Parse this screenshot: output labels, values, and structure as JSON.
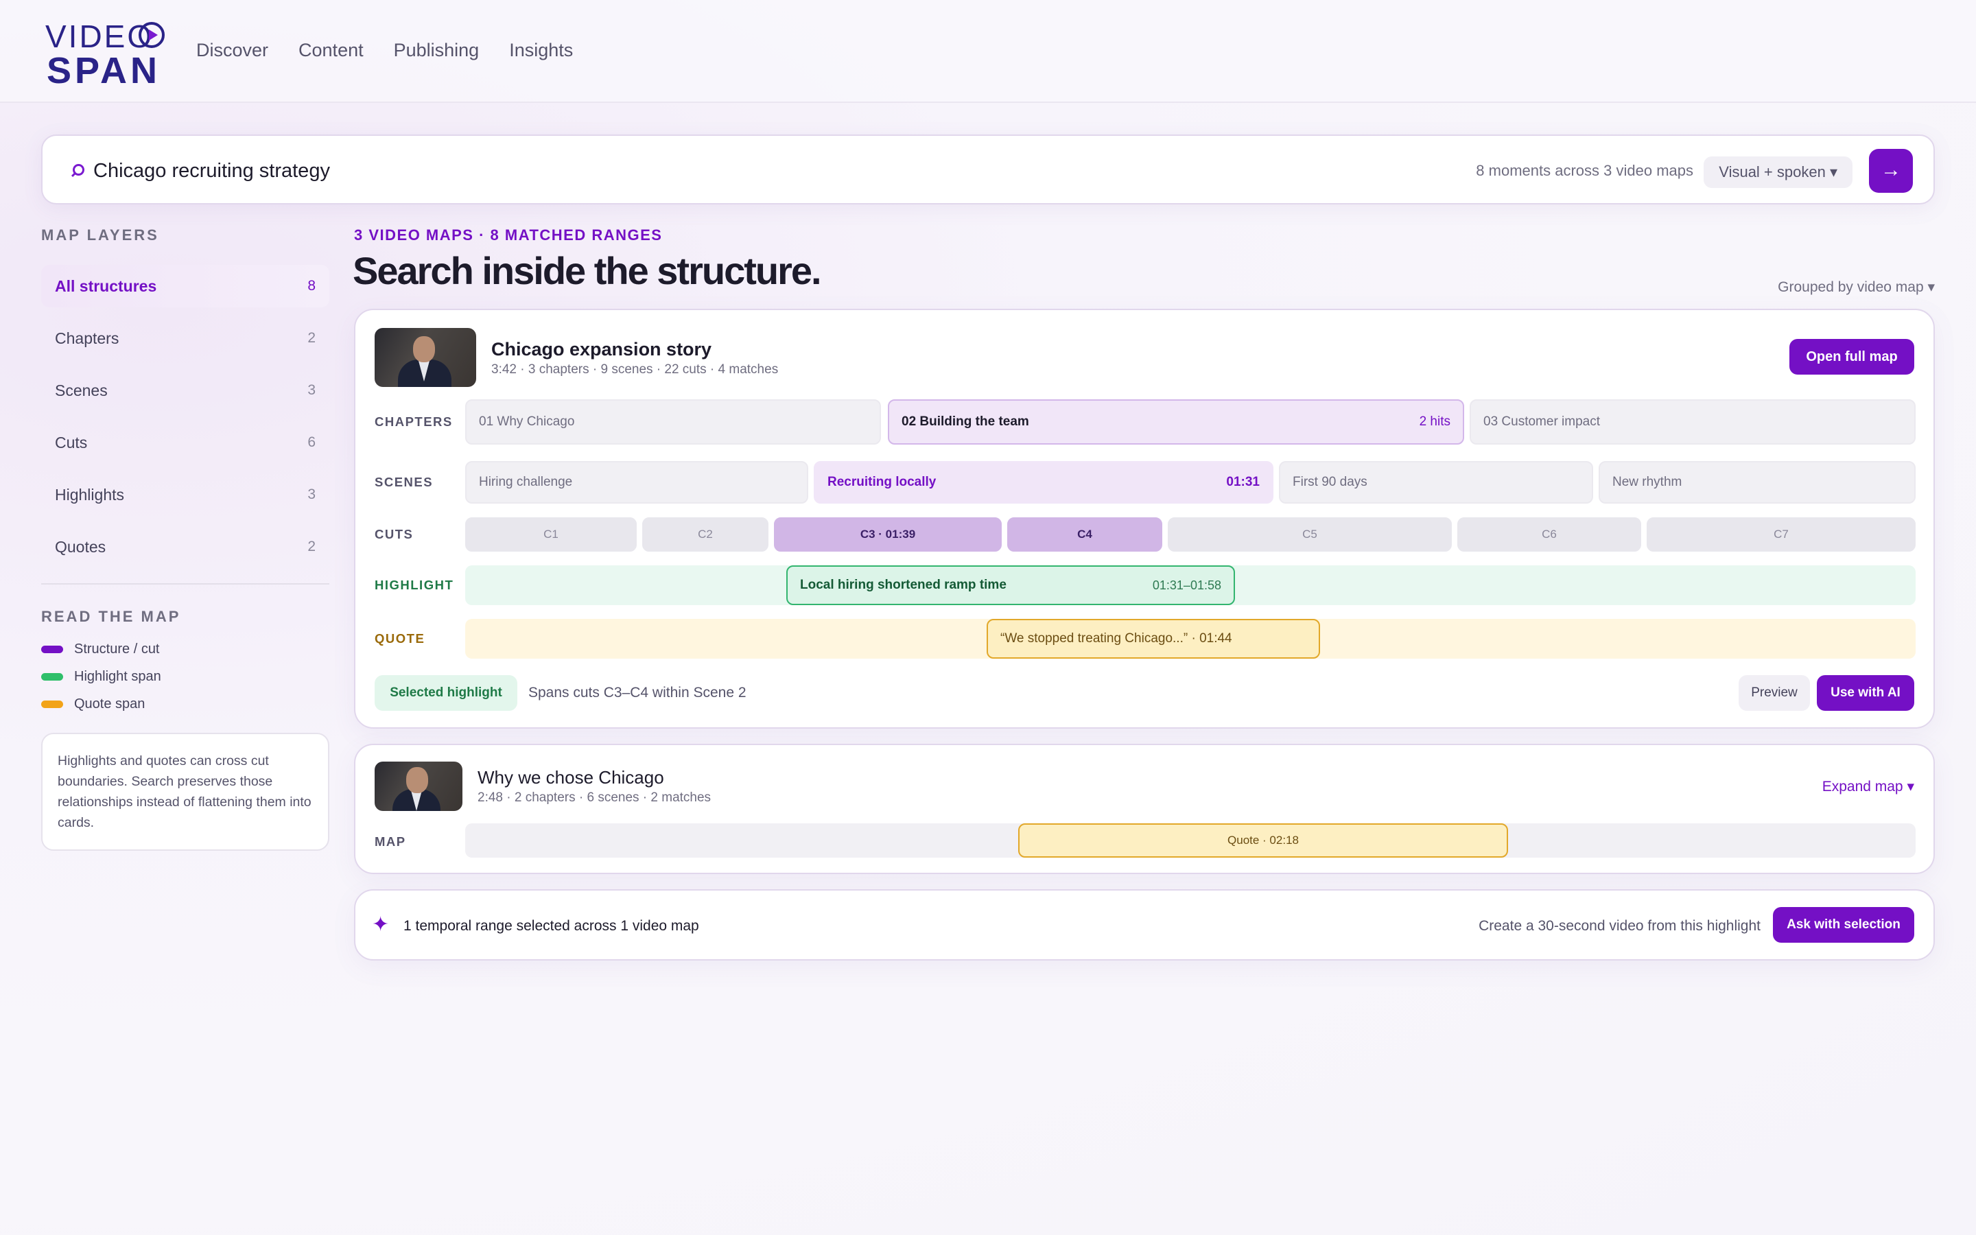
{
  "logo": {
    "line1": "VIDEO",
    "line2": "SPAN"
  },
  "nav": [
    "Discover",
    "Content",
    "Publishing",
    "Insights"
  ],
  "search": {
    "query": "Chicago recruiting strategy",
    "meta": "8 moments across 3 video maps",
    "mode": "Visual + spoken ▾",
    "go": "→"
  },
  "sidebar": {
    "title": "MAP LAYERS",
    "layers": [
      {
        "label": "All structures",
        "count": "8"
      },
      {
        "label": "Chapters",
        "count": "2"
      },
      {
        "label": "Scenes",
        "count": "3"
      },
      {
        "label": "Cuts",
        "count": "6"
      },
      {
        "label": "Highlights",
        "count": "3"
      },
      {
        "label": "Quotes",
        "count": "2"
      }
    ],
    "legend_title": "READ THE MAP",
    "legend": [
      {
        "label": "Structure / cut",
        "color": "#7410c5"
      },
      {
        "label": "Highlight span",
        "color": "#2fbf6a"
      },
      {
        "label": "Quote span",
        "color": "#f2a318"
      }
    ],
    "note": "Highlights and quotes can cross cut boundaries. Search preserves those relationships instead of flattening them into cards."
  },
  "main": {
    "kicker": "3 VIDEO MAPS · 8 MATCHED RANGES",
    "headline": "Search inside the structure.",
    "grouped": "Grouped by video map ▾"
  },
  "card1": {
    "title": "Chicago expansion story",
    "sub": "3:42 · 3 chapters · 9 scenes · 22 cuts · 4 matches",
    "open": "Open full map",
    "labels": {
      "chapters": "CHAPTERS",
      "scenes": "SCENES",
      "cuts": "CUTS",
      "highlight": "HIGHLIGHT",
      "quote": "QUOTE"
    },
    "chapters": [
      {
        "label": "01 Why Chicago"
      },
      {
        "label": "02 Building the team",
        "hits": "2 hits"
      },
      {
        "label": "03 Customer impact"
      }
    ],
    "scenes": [
      {
        "label": "Hiring challenge"
      },
      {
        "label": "Recruiting locally",
        "time": "01:31"
      },
      {
        "label": "First 90 days"
      },
      {
        "label": "New rhythm"
      }
    ],
    "cuts": [
      "C1",
      "C2",
      "C3 · 01:39",
      "C4",
      "C5",
      "C6",
      "C7"
    ],
    "highlight": {
      "label": "Local hiring shortened ramp time",
      "time": "01:31–01:58"
    },
    "quote": "“We stopped treating Chicago...” · 01:44",
    "selected": "Selected highlight",
    "selected_desc": "Spans cuts C3–C4 within Scene 2",
    "preview": "Preview",
    "use_ai": "Use with AI"
  },
  "card2": {
    "title": "Why we chose Chicago",
    "sub": "2:48 · 2 chapters · 6 scenes · 2 matches",
    "expand": "Expand map ▾",
    "map_label": "MAP",
    "quote": "Quote · 02:18"
  },
  "card3": {
    "icon": "✦",
    "text": "1 temporal range selected across 1 video map",
    "hint": "Create a 30-second video from this highlight",
    "ask": "Ask with selection"
  }
}
